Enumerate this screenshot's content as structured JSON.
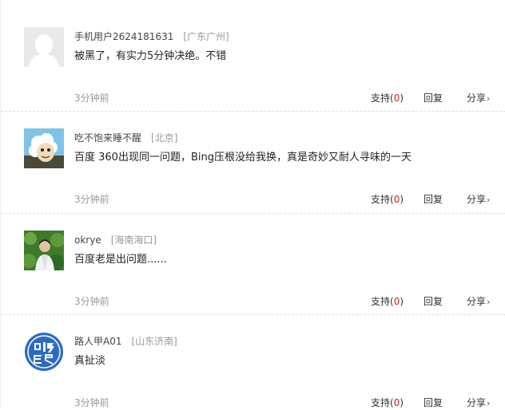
{
  "actions": {
    "support_label": "支持(",
    "support_close": ")",
    "reply_label": "回复",
    "share_label": "分享",
    "share_chevron": "›"
  },
  "comments": [
    {
      "username": "手机用户2624181631",
      "location": "[广东广州]",
      "text": "被黑了，有实力5分钟决绝。不错",
      "time": "3分钟前",
      "support_count": "0",
      "avatar": "default-silhouette-icon"
    },
    {
      "username": "吃不饱来睡不醒",
      "location": "[北京]",
      "text": "百度 360出现同一问题，Bing压根没给我换，真是奇妙又耐人寻味的一天",
      "time": "3分钟前",
      "support_count": "0",
      "avatar": "sheep-cartoon-avatar"
    },
    {
      "username": "okrye",
      "location": "[海南海口]",
      "text": "百度老是出问题......",
      "time": "3分钟前",
      "support_count": "0",
      "avatar": "person-photo-avatar"
    },
    {
      "username": "路人甲A01",
      "location": "[山东济南]",
      "text": "真扯淡",
      "time": "3分钟前",
      "support_count": "0",
      "avatar": "blue-logo-avatar"
    }
  ],
  "colors": {
    "support_count": "#cc2222",
    "location": "#999999",
    "avatar_blue": "#2a6bc4"
  }
}
